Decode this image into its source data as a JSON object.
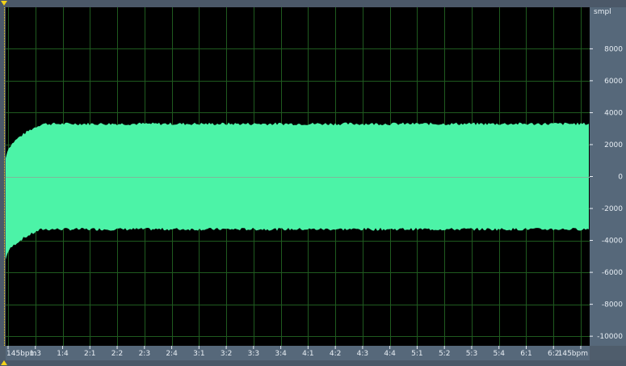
{
  "colors": {
    "background": "#000000",
    "waveform": "#4cf3a7",
    "grid": "#1f5a1f",
    "ruler": "#56687a",
    "marker": "#f2d21a",
    "text": "#e8eef4"
  },
  "y_axis": {
    "unit": "smpl",
    "ticks": [
      "8000",
      "6000",
      "4000",
      "2000",
      "0",
      "-2000",
      "-4000",
      "-6000",
      "-8000",
      "-10000"
    ],
    "values": [
      8000,
      6000,
      4000,
      2000,
      0,
      -2000,
      -4000,
      -6000,
      -8000,
      -10000
    ],
    "max": 10600,
    "min": -10600
  },
  "x_axis": {
    "ticks": [
      "145bpm",
      "1:3",
      "1:4",
      "2:1",
      "2:2",
      "2:3",
      "2:4",
      "3:1",
      "3:2",
      "3:3",
      "3:4",
      "4:1",
      "4:2",
      "4:3",
      "4:4",
      "5:1",
      "5:2",
      "5:3",
      "5:4",
      "6:1",
      "6:2",
      "145bpm"
    ]
  },
  "waveform": {
    "envelope_upper": 3300,
    "envelope_lower": -3300,
    "attack_peak_lower": -5200
  }
}
